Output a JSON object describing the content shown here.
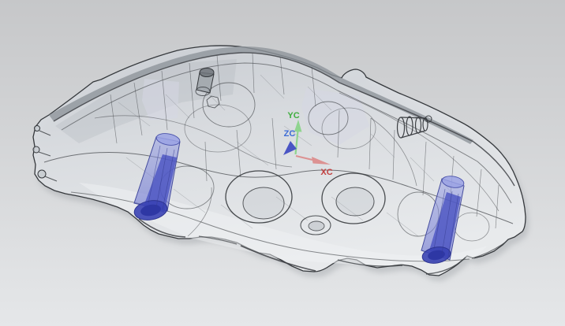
{
  "viewport": {
    "name": "3d-cad-viewport",
    "background_top": "#c6c7c9",
    "background_bottom": "#e5e7e9"
  },
  "model": {
    "description": "translucent wireframe brake caliper body",
    "edge_color": "#35383c",
    "wire_color": "#3f4246",
    "light_wire_color": "#85898e",
    "piston_light": "#9aa2e4",
    "piston_mid": "#5a63cc",
    "piston_core": "#4a53c2",
    "piston_base": "#3a43b4",
    "piston_base_dark": "#2e37a4"
  },
  "triad": {
    "x_label": "XC",
    "y_label": "YC",
    "z_label": "ZC",
    "x_label_color": "#c24040",
    "y_label_color": "#3fae3f",
    "z_label_color": "#3c6cd6",
    "x_arrow_color": "#dc9292",
    "y_arrow_color": "#8fd48f",
    "z_arrow_color": "#4a55c4"
  }
}
